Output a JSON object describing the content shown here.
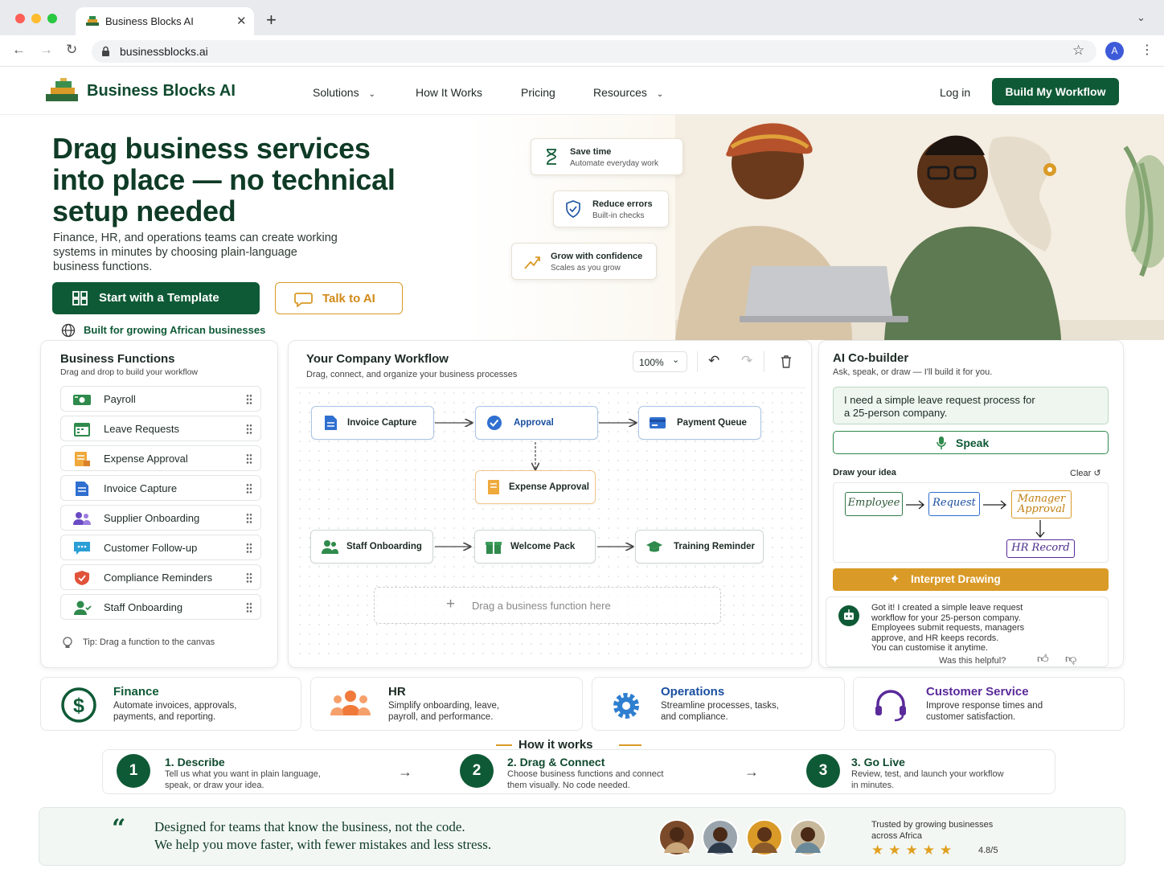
{
  "browser": {
    "tab_title": "Business Blocks AI",
    "url": "businessblocks.ai",
    "profile_initial": "A"
  },
  "header": {
    "brand": "Business Blocks AI",
    "nav": [
      "Solutions",
      "How It Works",
      "Pricing",
      "Resources"
    ],
    "login": "Log in",
    "cta": "Build My Workflow"
  },
  "hero": {
    "title_line1": "Drag business services",
    "title_line2": "into place — no technical",
    "title_line3": "setup needed",
    "subtitle_line1": "Finance, HR, and operations teams can create working",
    "subtitle_line2": "systems in minutes by choosing plain-language",
    "subtitle_line3": "business functions.",
    "primary_button": "Start with a Template",
    "secondary_button": "Talk to AI",
    "tagline": "Built for growing African businesses",
    "badges": [
      {
        "title": "Save time",
        "subtitle": "Automate everyday work"
      },
      {
        "title": "Reduce errors",
        "subtitle": "Built-in checks"
      },
      {
        "title": "Grow with confidence",
        "subtitle": "Scales as you grow"
      }
    ]
  },
  "functions_panel": {
    "title": "Business Functions",
    "subtitle": "Drag and drop to build your workflow",
    "items": [
      {
        "label": "Payroll",
        "icon": "payroll-icon"
      },
      {
        "label": "Leave Requests",
        "icon": "calendar-icon"
      },
      {
        "label": "Expense Approval",
        "icon": "expense-icon"
      },
      {
        "label": "Invoice Capture",
        "icon": "invoice-icon"
      },
      {
        "label": "Supplier Onboarding",
        "icon": "supplier-icon"
      },
      {
        "label": "Customer Follow-up",
        "icon": "chat-icon"
      },
      {
        "label": "Compliance Reminders",
        "icon": "shield-icon"
      },
      {
        "label": "Staff Onboarding",
        "icon": "person-icon"
      }
    ],
    "tip": "Tip: Drag a function to the canvas"
  },
  "workflow": {
    "title": "Your Company Workflow",
    "subtitle": "Drag, connect, and organize your business processes",
    "zoom": "100%",
    "nodes": {
      "invoice_capture": "Invoice Capture",
      "approval": "Approval",
      "payment_queue": "Payment Queue",
      "expense_approval": "Expense Approval",
      "staff_onboarding": "Staff Onboarding",
      "welcome_pack": "Welcome Pack",
      "training_reminder": "Training Reminder"
    },
    "drop_zone": "Drag a business function here"
  },
  "cobuilder": {
    "title": "AI Co-builder",
    "subtitle": "Ask, speak, or draw — I'll build it for you.",
    "prompt_line1": "I need a simple leave request process for",
    "prompt_line2": "a 25-person company.",
    "speak": "Speak",
    "draw_label": "Draw your idea",
    "clear": "Clear",
    "sketch": {
      "employee": "Employee",
      "request": "Request",
      "manager_line1": "Manager",
      "manager_line2": "Approval",
      "hr_record": "HR Record"
    },
    "interpret": "Interpret Drawing",
    "response_lines": [
      "Got it! I created a simple leave request",
      "workflow for your 25-person company.",
      "Employees submit requests, managers",
      "approve, and HR keeps records.",
      "You can customise it anytime."
    ],
    "helpful": "Was this helpful?"
  },
  "categories": [
    {
      "title": "Finance",
      "line1": "Automate invoices, approvals,",
      "line2": "payments, and reporting.",
      "color": "#0f5a36",
      "icon": "dollar-icon"
    },
    {
      "title": "HR",
      "line1": "Simplify onboarding, leave,",
      "line2": "payroll, and performance.",
      "color": "#1d2b24",
      "icon": "team-icon"
    },
    {
      "title": "Operations",
      "line1": "Streamline processes, tasks,",
      "line2": "and compliance.",
      "color": "#1a4fa0",
      "icon": "gear-icon"
    },
    {
      "title": "Customer Service",
      "line1": "Improve response times and",
      "line2": "customer satisfaction.",
      "color": "#5a2a9a",
      "icon": "headset-icon"
    }
  ],
  "how_it_works": {
    "title": "How it works",
    "steps": [
      {
        "num": "1",
        "title": "1. Describe",
        "line1": "Tell us what you want in plain language,",
        "line2": "speak, or draw your idea."
      },
      {
        "num": "2",
        "title": "2. Drag & Connect",
        "line1": "Choose business functions and connect",
        "line2": "them visually. No code needed."
      },
      {
        "num": "3",
        "title": "3. Go Live",
        "line1": "Review, test, and launch your workflow",
        "line2": "in minutes."
      }
    ]
  },
  "testimonial": {
    "quote_line1": "Designed for teams that know the business, not the code.",
    "quote_line2": "We help you move faster, with fewer mistakes and less stress.",
    "trusted_line1": "Trusted by growing businesses",
    "trusted_line2": "across Africa",
    "rating": "4.8/5",
    "stars": 5
  },
  "colors": {
    "brand_green": "#0f5a36",
    "accent_orange": "#d99a27",
    "node_blue": "#a9c4e6"
  }
}
